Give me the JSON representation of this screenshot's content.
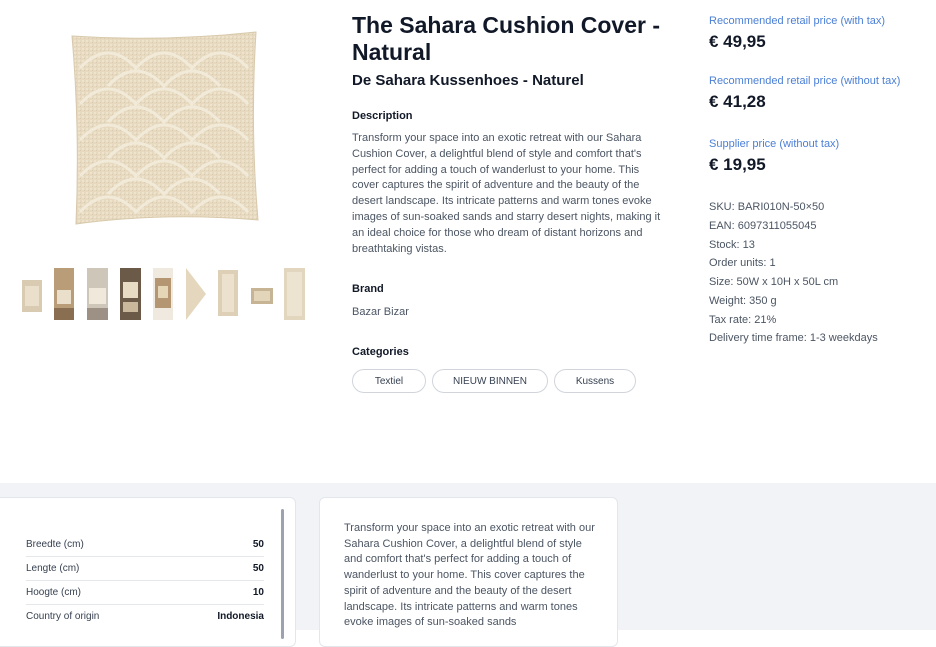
{
  "product": {
    "title": "The Sahara Cushion Cover - Natural",
    "subtitle": "De Sahara Kussenhoes - Naturel",
    "description_heading": "Description",
    "description": "Transform your space into an exotic retreat with our Sahara Cushion Cover, a delightful blend of style and comfort that's perfect for adding a touch of wanderlust to your home. This cover captures the spirit of adventure and the beauty of the desert landscape. Its intricate patterns and warm tones evoke images of sun-soaked sands and starry desert nights, making it an ideal choice for those who dream of distant horizons and breathtaking vistas.",
    "brand_heading": "Brand",
    "brand": "Bazar Bizar",
    "categories_heading": "Categories",
    "categories": [
      "Textiel",
      "NIEUW BINNEN",
      "Kussens"
    ]
  },
  "pricing": {
    "retail_with_tax_label": "Recommended retail price (with tax)",
    "retail_with_tax": "€ 49,95",
    "retail_without_tax_label": "Recommended retail price (without tax)",
    "retail_without_tax": "€ 41,28",
    "supplier_label": "Supplier price (without tax)",
    "supplier": "€ 19,95"
  },
  "specs": [
    "SKU: BARI010N-50×50",
    "EAN: 6097311055045",
    "Stock: 13",
    "Order units: 1",
    "Size: 50W x 10H x 50L cm",
    "Weight: 350 g",
    "Tax rate: 21%",
    "Delivery time frame: 1-3 weekdays"
  ],
  "gallery": {
    "main_image": "cushion-image",
    "thumbnail_count": 9
  },
  "spec_table": [
    {
      "key": "Breedte (cm)",
      "value": "50"
    },
    {
      "key": "Lengte (cm)",
      "value": "50"
    },
    {
      "key": "Hoogte (cm)",
      "value": "10"
    },
    {
      "key": "Country of origin",
      "value": "Indonesia"
    }
  ],
  "long_description": "Transform your space into an exotic retreat with our Sahara Cushion Cover, a delightful blend of style and comfort that's perfect for adding a touch of wanderlust to your home. This cover captures the spirit of adventure and the beauty of the desert landscape. Its intricate patterns and warm tones evoke images of sun-soaked sands",
  "colors": {
    "price_label": "#4b7fd6",
    "page_bg_bottom": "#f1f3f6",
    "cushion": "#e8dcc4"
  }
}
